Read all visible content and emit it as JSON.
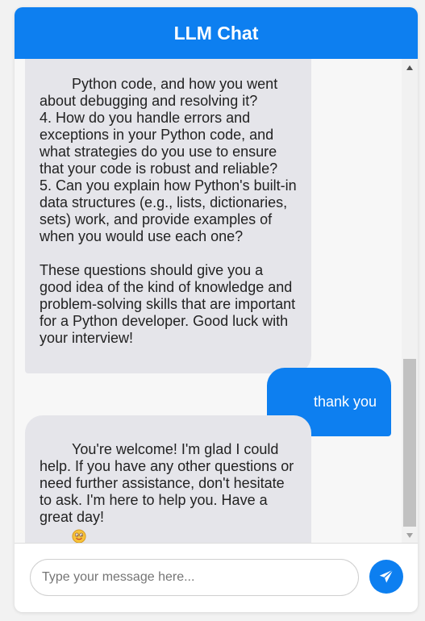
{
  "header": {
    "title": "LLM Chat"
  },
  "messages": [
    {
      "role": "assistant",
      "text": "Python code, and how you went about debugging and resolving it?\n4. How do you handle errors and exceptions in your Python code, and what strategies do you use to ensure that your code is robust and reliable?\n5. Can you explain how Python's built-in data structures (e.g., lists, dictionaries, sets) work, and provide examples of when you would use each one?\n\nThese questions should give you a good idea of the kind of knowledge and problem-solving skills that are important for a Python developer. Good luck with your interview!"
    },
    {
      "role": "user",
      "text": "thank you"
    },
    {
      "role": "assistant",
      "text": "You're welcome! I'm glad I could help. If you have any other questions or need further assistance, don't hesitate to ask. I'm here to help you. Have a great day! ",
      "emoji": "smiling-face-icon"
    }
  ],
  "composer": {
    "placeholder": "Type your message here...",
    "value": "",
    "send_icon": "paper-plane-icon"
  },
  "colors": {
    "accent": "#0d7ff0",
    "bot_bubble": "#e5e5ea",
    "background": "#f7f7f7"
  }
}
